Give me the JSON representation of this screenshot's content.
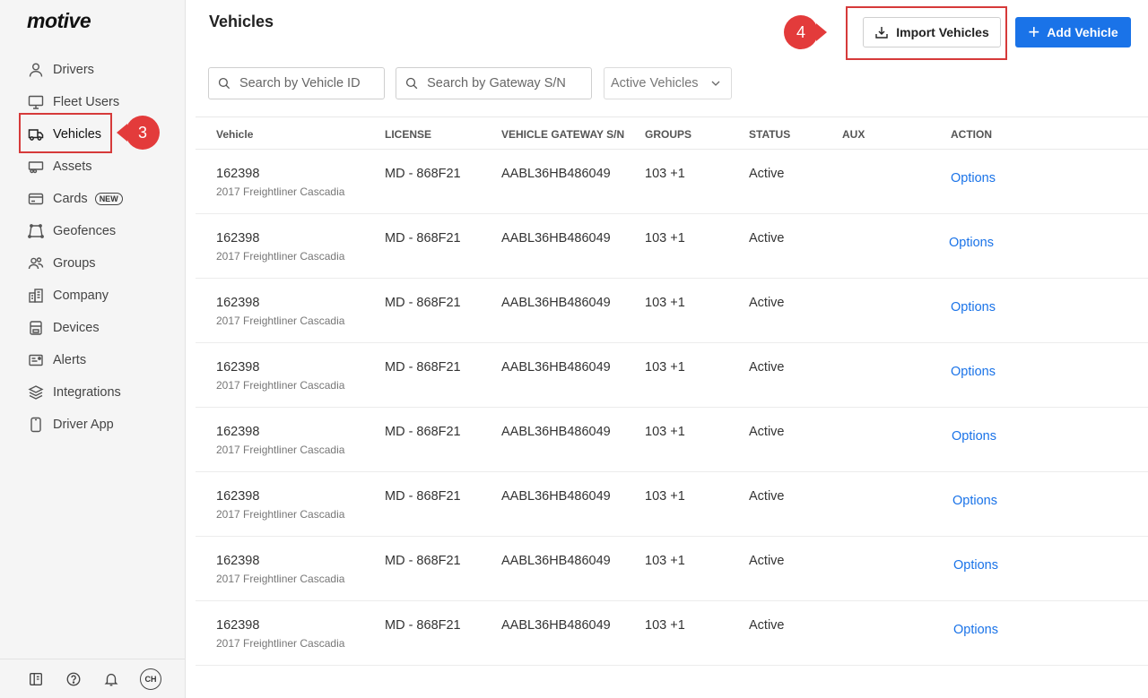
{
  "app": {
    "logo": "motive"
  },
  "sidebar": {
    "items": [
      {
        "label": "Drivers",
        "icon": "person-icon"
      },
      {
        "label": "Fleet Users",
        "icon": "monitor-icon"
      },
      {
        "label": "Vehicles",
        "icon": "truck-icon"
      },
      {
        "label": "Assets",
        "icon": "trailer-icon"
      },
      {
        "label": "Cards",
        "icon": "card-icon",
        "badge": "NEW"
      },
      {
        "label": "Geofences",
        "icon": "geofence-icon"
      },
      {
        "label": "Groups",
        "icon": "groups-icon"
      },
      {
        "label": "Company",
        "icon": "building-icon"
      },
      {
        "label": "Devices",
        "icon": "device-icon"
      },
      {
        "label": "Alerts",
        "icon": "alert-icon"
      },
      {
        "label": "Integrations",
        "icon": "layers-icon"
      },
      {
        "label": "Driver App",
        "icon": "phone-icon"
      }
    ],
    "footer": {
      "avatar": "CH"
    }
  },
  "callouts": {
    "step3": "3",
    "step4": "4"
  },
  "header": {
    "title": "Vehicles",
    "import_label": "Import Vehicles",
    "add_label": "Add Vehicle"
  },
  "filters": {
    "vehicle_search_placeholder": "Search by Vehicle ID",
    "gateway_search_placeholder": "Search by Gateway S/N",
    "status_select": "Active Vehicles"
  },
  "table": {
    "columns": [
      "Vehicle",
      "LICENSE",
      "VEHICLE GATEWAY S/N",
      "GROUPS",
      "STATUS",
      "AUX",
      "ACTION"
    ],
    "rows": [
      {
        "id": "162398",
        "model": "2017 Freightliner Cascadia",
        "license": "MD - 868F21",
        "gateway": "AABL36HB486049",
        "groups": "103 +1",
        "status": "Active",
        "aux": "",
        "action": "Options"
      },
      {
        "id": "162398",
        "model": "2017 Freightliner Cascadia",
        "license": "MD - 868F21",
        "gateway": "AABL36HB486049",
        "groups": "103 +1",
        "status": "Active",
        "aux": "",
        "action": "Options"
      },
      {
        "id": "162398",
        "model": "2017 Freightliner Cascadia",
        "license": "MD - 868F21",
        "gateway": "AABL36HB486049",
        "groups": "103 +1",
        "status": "Active",
        "aux": "",
        "action": "Options"
      },
      {
        "id": "162398",
        "model": "2017 Freightliner Cascadia",
        "license": "MD - 868F21",
        "gateway": "AABL36HB486049",
        "groups": "103 +1",
        "status": "Active",
        "aux": "",
        "action": "Options"
      },
      {
        "id": "162398",
        "model": "2017 Freightliner Cascadia",
        "license": "MD - 868F21",
        "gateway": "AABL36HB486049",
        "groups": "103 +1",
        "status": "Active",
        "aux": "",
        "action": "Options"
      },
      {
        "id": "162398",
        "model": "2017 Freightliner Cascadia",
        "license": "MD - 868F21",
        "gateway": "AABL36HB486049",
        "groups": "103 +1",
        "status": "Active",
        "aux": "",
        "action": "Options"
      },
      {
        "id": "162398",
        "model": "2017 Freightliner Cascadia",
        "license": "MD - 868F21",
        "gateway": "AABL36HB486049",
        "groups": "103 +1",
        "status": "Active",
        "aux": "",
        "action": "Options"
      },
      {
        "id": "162398",
        "model": "2017 Freightliner Cascadia",
        "license": "MD - 868F21",
        "gateway": "AABL36HB486049",
        "groups": "103 +1",
        "status": "Active",
        "aux": "",
        "action": "Options"
      }
    ]
  },
  "colors": {
    "accent": "#1a73e8",
    "callout": "#e33b3b",
    "sidebar_bg": "#f5f5f5"
  }
}
